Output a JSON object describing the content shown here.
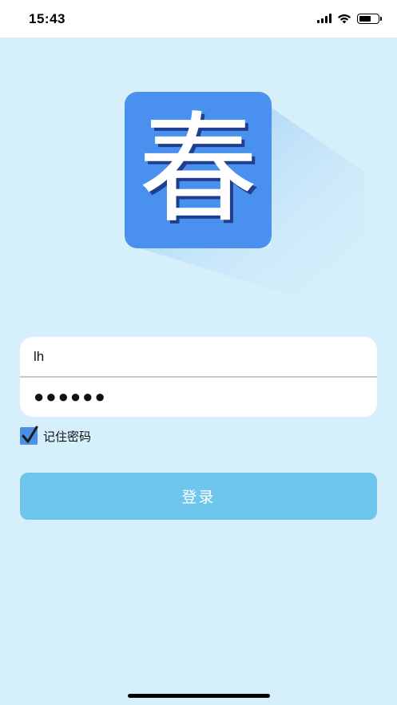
{
  "status_bar": {
    "time": "15:43"
  },
  "logo": {
    "char": "春",
    "bg_color": "#4a90ee"
  },
  "login_form": {
    "username_value": "lh",
    "password_mask": "●●●●●●",
    "remember_checked": true,
    "remember_label": "记住密码",
    "login_button_label": "登录",
    "button_color": "#6fc6ec"
  },
  "colors": {
    "background": "#d5effb",
    "checkbox": "#4b8fe6"
  }
}
